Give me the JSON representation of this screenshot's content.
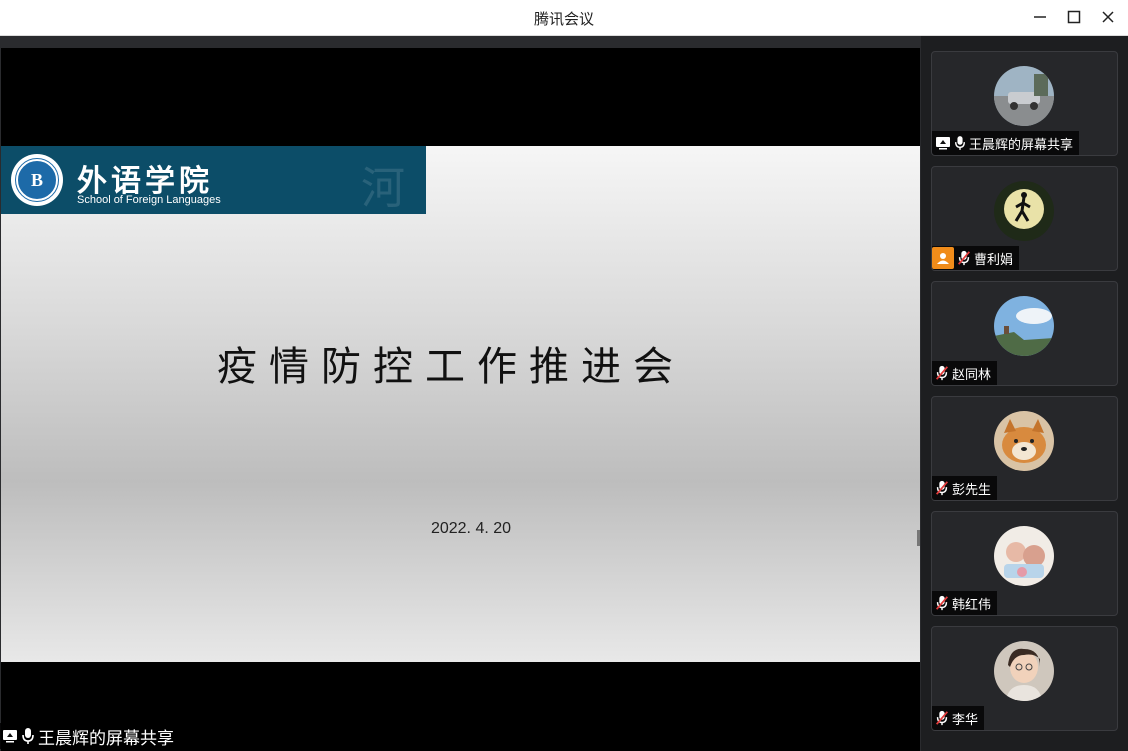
{
  "window": {
    "title": "腾讯会议",
    "minimize_icon": "minimize-icon",
    "maximize_icon": "maximize-icon",
    "close_icon": "close-icon"
  },
  "main_share": {
    "slide": {
      "logo_cn": "外语学院",
      "logo_en": "School of Foreign Languages",
      "title": "疫情防控工作推进会",
      "date": "2022. 4. 20"
    },
    "share_label": "王晨辉的屏幕共享",
    "share_icon": "screen-share-icon",
    "mic_icon": "microphone-icon"
  },
  "participants": [
    {
      "name": "王晨辉的屏幕共享",
      "mic": "on",
      "screen_share": true,
      "host_badge": false
    },
    {
      "name": "曹利娟",
      "mic": "muted",
      "screen_share": false,
      "host_badge": true
    },
    {
      "name": "赵同林",
      "mic": "muted",
      "screen_share": false,
      "host_badge": false
    },
    {
      "name": "彭先生",
      "mic": "muted",
      "screen_share": false,
      "host_badge": false
    },
    {
      "name": "韩红伟",
      "mic": "muted",
      "screen_share": false,
      "host_badge": false
    },
    {
      "name": "李华",
      "mic": "muted",
      "screen_share": false,
      "host_badge": false
    }
  ],
  "colors": {
    "logo_band": "#0c4d68",
    "host_badge": "#f08c1a",
    "muted_icon": "#e23b3b"
  }
}
